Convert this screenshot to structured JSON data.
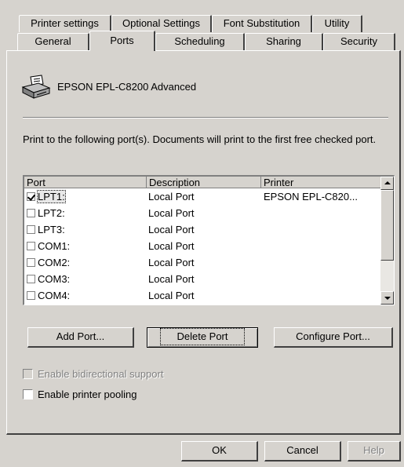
{
  "tabs_back": [
    {
      "label": "Printer settings"
    },
    {
      "label": "Optional Settings"
    },
    {
      "label": "Font Substitution"
    },
    {
      "label": "Utility"
    }
  ],
  "tabs_front": [
    {
      "label": "General"
    },
    {
      "label": "Ports",
      "selected": true
    },
    {
      "label": "Scheduling"
    },
    {
      "label": "Sharing"
    },
    {
      "label": "Security"
    }
  ],
  "printer": {
    "icon": "printer-icon",
    "name": "EPSON EPL-C8200 Advanced"
  },
  "ports_description": "Print to the following port(s).  Documents will print to the first free checked port.",
  "ports_description_mnemonic": "P",
  "port_list": {
    "columns": [
      "Port",
      "Description",
      "Printer"
    ],
    "rows": [
      {
        "port": "LPT1:",
        "description": "Local Port",
        "printer": "EPSON EPL-C820...",
        "checked": true,
        "selected": true
      },
      {
        "port": "LPT2:",
        "description": "Local Port",
        "printer": "",
        "checked": false
      },
      {
        "port": "LPT3:",
        "description": "Local Port",
        "printer": "",
        "checked": false
      },
      {
        "port": "COM1:",
        "description": "Local Port",
        "printer": "",
        "checked": false
      },
      {
        "port": "COM2:",
        "description": "Local Port",
        "printer": "",
        "checked": false
      },
      {
        "port": "COM3:",
        "description": "Local Port",
        "printer": "",
        "checked": false
      },
      {
        "port": "COM4:",
        "description": "Local Port",
        "printer": "",
        "checked": false
      }
    ]
  },
  "port_buttons": {
    "add": "Add Port...",
    "delete": "Delete Port",
    "configure": "Configure Port..."
  },
  "options": {
    "bidirectional": {
      "label": "Enable bidirectional support",
      "checked": false,
      "enabled": false
    },
    "pooling": {
      "label": "Enable printer pooling",
      "checked": false,
      "enabled": true
    }
  },
  "dialog_buttons": {
    "ok": "OK",
    "cancel": "Cancel",
    "help": "Help"
  },
  "colors": {
    "face": "#d6d3ce",
    "shadow": "#808080",
    "dark_shadow": "#404040",
    "highlight": "#ffffff"
  }
}
